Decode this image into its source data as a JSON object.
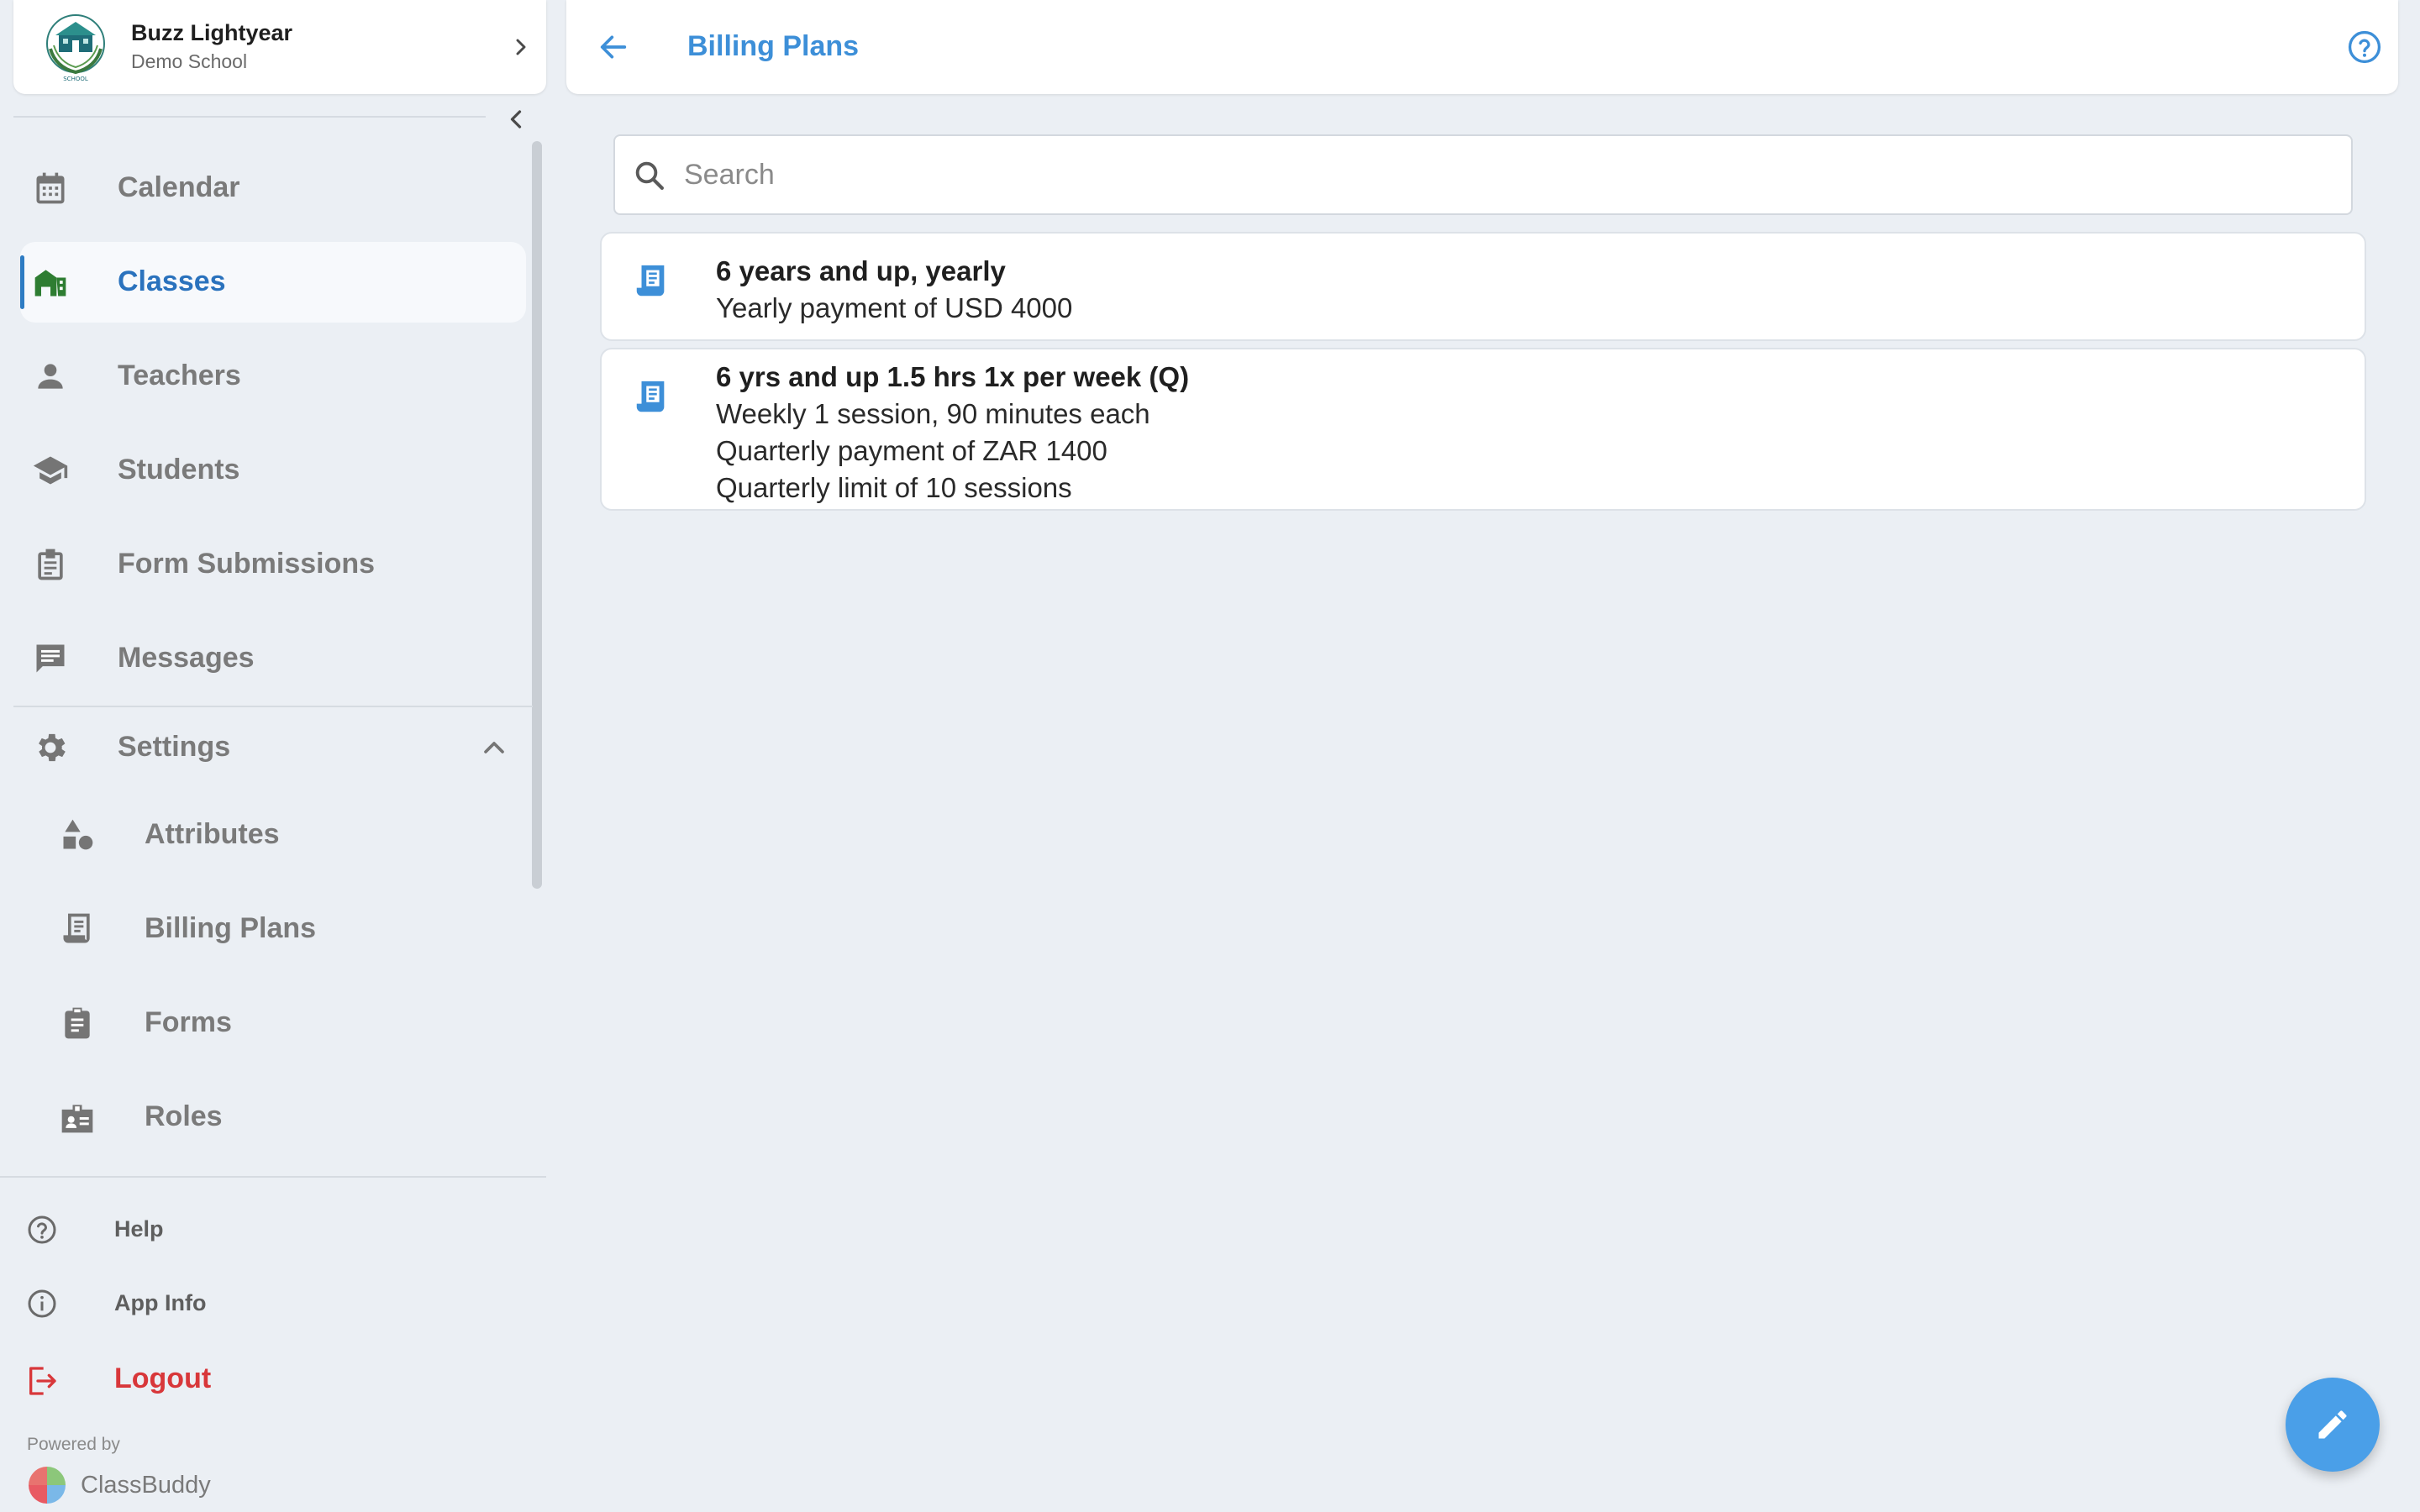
{
  "profile": {
    "user_name": "Buzz Lightyear",
    "school_name": "Demo School",
    "logo_text": "SCHOOL"
  },
  "nav": {
    "calendar": "Calendar",
    "classes": "Classes",
    "teachers": "Teachers",
    "students": "Students",
    "form_submissions": "Form Submissions",
    "messages": "Messages",
    "settings": "Settings",
    "active": "classes"
  },
  "settings_menu": {
    "attributes": "Attributes",
    "billing_plans": "Billing Plans",
    "forms": "Forms",
    "roles": "Roles"
  },
  "footer": {
    "help": "Help",
    "app_info": "App Info",
    "logout": "Logout",
    "powered_by": "Powered by",
    "brand": "ClassBuddy"
  },
  "header": {
    "title": "Billing Plans"
  },
  "search": {
    "placeholder": "Search",
    "value": ""
  },
  "plans": [
    {
      "title": "6 years and up, yearly",
      "lines": [
        "Yearly payment of USD 4000"
      ]
    },
    {
      "title": "6 yrs and up 1.5 hrs 1x per week (Q)",
      "lines": [
        "Weekly 1 session, 90 minutes each",
        "Quarterly payment of ZAR 1400",
        "Quarterly limit of 10 sessions"
      ]
    }
  ],
  "colors": {
    "accent": "#3d8fd8",
    "active_nav": "#2a72bd",
    "logout": "#d8373a",
    "background": "#ebeff4",
    "fab": "#4a9fe8"
  },
  "icons": {
    "calendar": "calendar-icon",
    "classes": "school-building-icon",
    "teachers": "person-icon",
    "students": "graduation-cap-icon",
    "form_submissions": "clipboard-list-icon",
    "messages": "chat-message-icon",
    "settings": "gear-icon",
    "attributes": "shapes-icon",
    "billing_plans": "receipt-icon",
    "forms": "clipboard-icon",
    "roles": "id-badge-icon",
    "help": "help-circle-icon",
    "app_info": "info-circle-icon",
    "logout": "logout-icon",
    "fab": "pencil-icon"
  }
}
